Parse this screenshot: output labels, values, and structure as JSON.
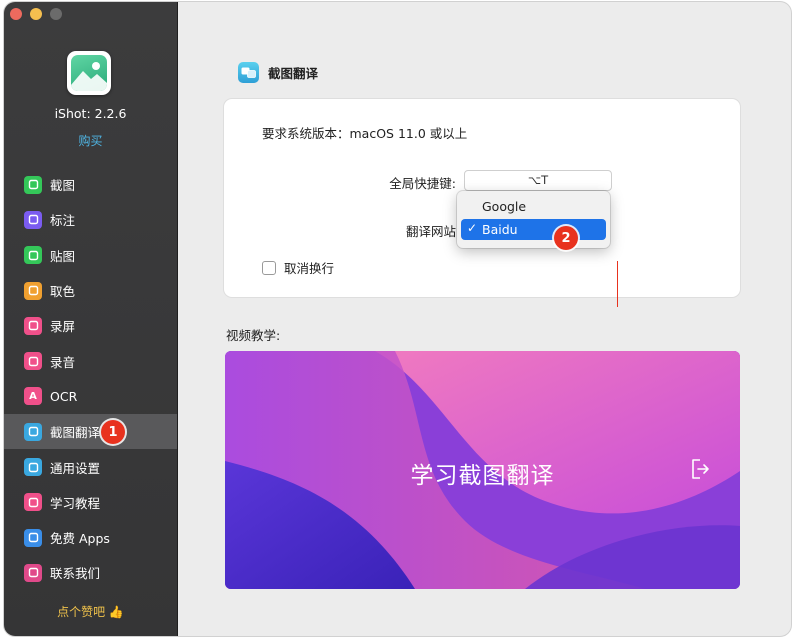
{
  "app": {
    "name_version": "iShot: 2.2.6",
    "buy_label": "购买"
  },
  "sidebar": {
    "items": [
      {
        "label": "截图",
        "icon": "screenshot-icon",
        "color": "#34c759"
      },
      {
        "label": "标注",
        "icon": "pointer-icon",
        "color": "#7b5cf0"
      },
      {
        "label": "贴图",
        "icon": "pin-icon",
        "color": "#34c759"
      },
      {
        "label": "取色",
        "icon": "eyedropper-icon",
        "color": "#f0a030"
      },
      {
        "label": "录屏",
        "icon": "screen-record-icon",
        "color": "#f0508a"
      },
      {
        "label": "录音",
        "icon": "microphone-icon",
        "color": "#f0508a"
      },
      {
        "label": "OCR",
        "icon": "ocr-icon",
        "color": "#f0508a",
        "glyph": "A"
      },
      {
        "label": "截图翻译",
        "icon": "translate-icon",
        "color": "#3aa8e0"
      },
      {
        "label": "通用设置",
        "icon": "gear-icon",
        "color": "#3aa8e0"
      },
      {
        "label": "学习教程",
        "icon": "play-icon",
        "color": "#f0508a"
      },
      {
        "label": "免费 Apps",
        "icon": "app-store-icon",
        "color": "#3a8ee8"
      },
      {
        "label": "联系我们",
        "icon": "contact-icon",
        "color": "#e04a8a"
      }
    ],
    "active_index": 7,
    "footer_label": "点个赞吧 👍"
  },
  "annotations": {
    "badge1": "1",
    "badge2": "2",
    "color": "#e8321e"
  },
  "main": {
    "section_title": "截图翻译",
    "requirement": "要求系统版本：macOS 11.0 或以上",
    "shortcut_label": "全局快捷键:",
    "shortcut_value": "⌥T",
    "site_label": "翻译网站",
    "dropdown": {
      "options": [
        "Google",
        "Baidu"
      ],
      "selected": "Baidu",
      "check": "✓"
    },
    "checkbox_label": "取消换行",
    "checkbox_checked": false,
    "video_heading": "视频教学:",
    "video_title": "学习截图翻译"
  },
  "colors": {
    "accent": "#1e73e8",
    "link": "#4fb6e6",
    "footer": "#f0c24b"
  }
}
